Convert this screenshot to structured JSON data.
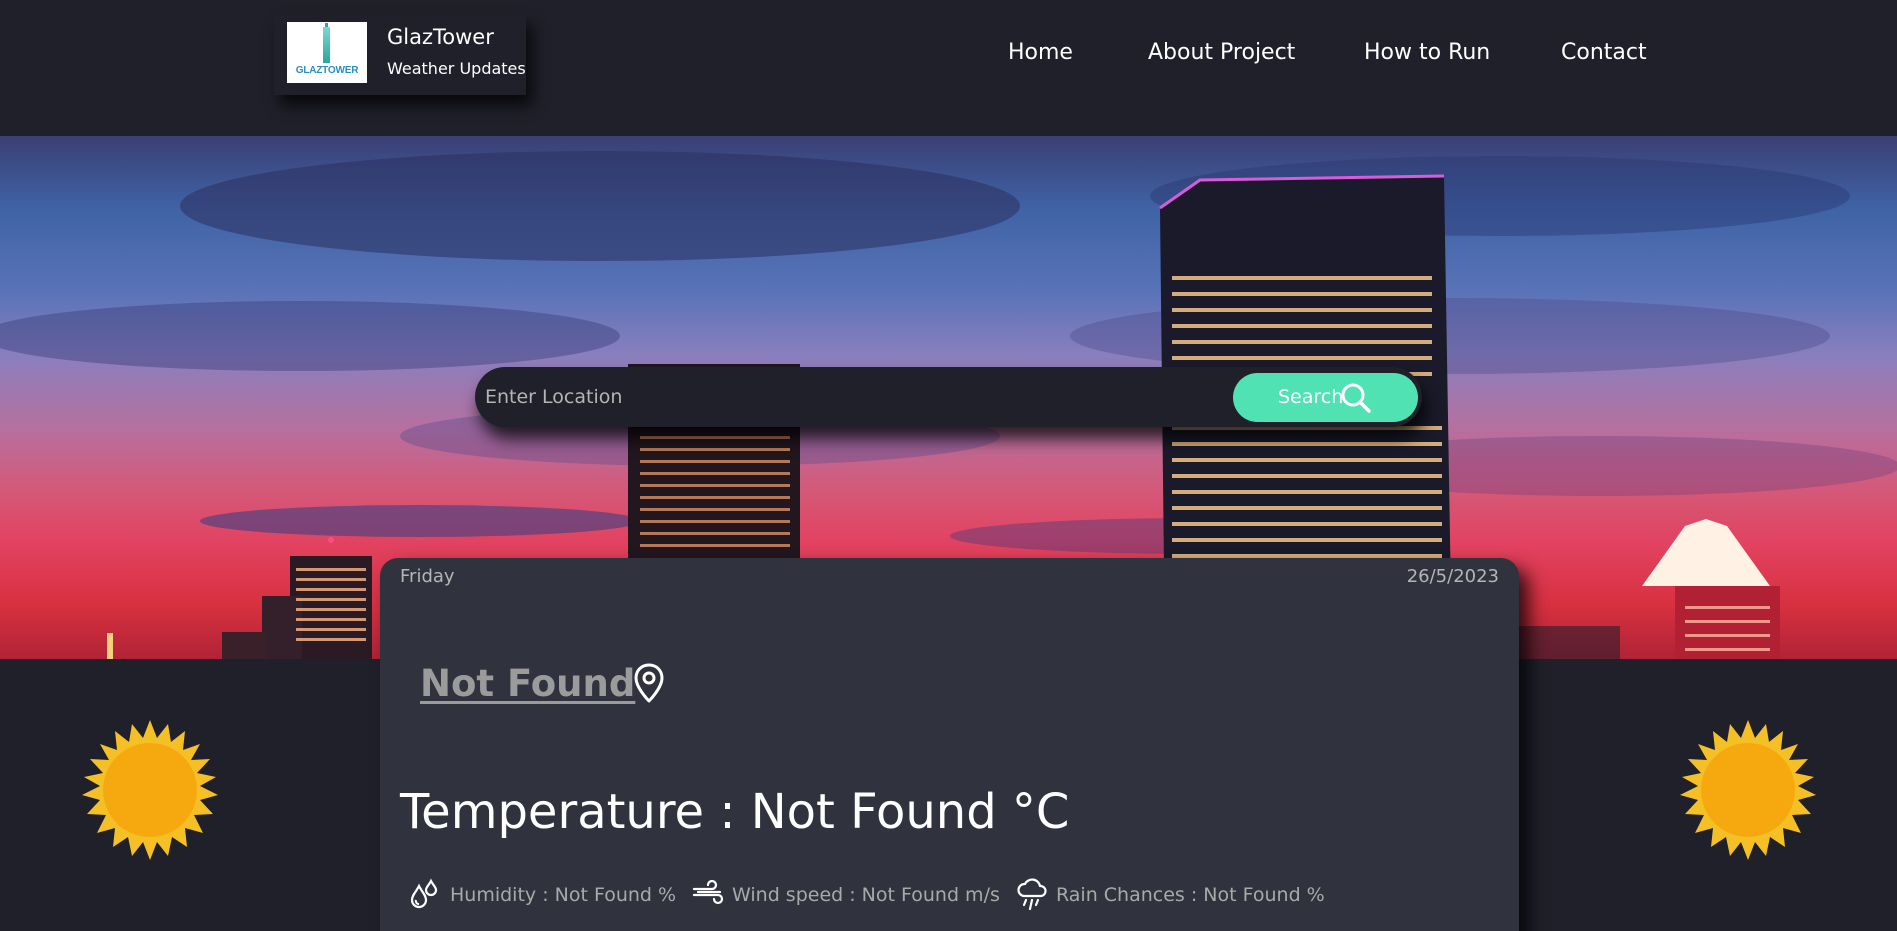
{
  "header": {
    "logo_text": "GLAZTOWER",
    "brand_title": "GlazTower",
    "brand_subtitle": "Weather Updates",
    "nav": [
      "Home",
      "About Project",
      "How to Run",
      "Contact"
    ]
  },
  "search": {
    "placeholder": "Enter Location",
    "button_label": "Search",
    "button_icon": "search-icon"
  },
  "weather": {
    "day": "Friday",
    "date": "26/5/2023",
    "city": "Not Found",
    "city_icon": "map-pin-icon",
    "temperature": "Temperature : Not Found °C",
    "humidity": "Humidity : Not Found %",
    "wind": "Wind speed : Not Found m/s",
    "rain": "Rain Chances : Not Found %"
  },
  "colors": {
    "background": "#1f2029",
    "card": "#30323e",
    "accent": "#51e2b4",
    "sun": "#f5a90f"
  }
}
